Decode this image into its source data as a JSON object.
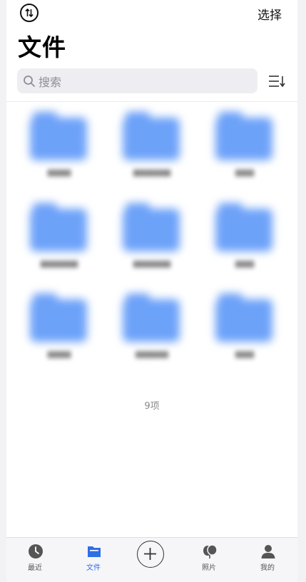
{
  "header": {
    "sync_icon": "sort-swap-icon",
    "select_label": "选择",
    "title": "文件"
  },
  "search": {
    "placeholder": "搜索",
    "icon": "search-icon"
  },
  "sort_icon": "sort-list-icon",
  "folders": [
    {
      "name": "▮▮▮▮▮",
      "icon": "folder-icon"
    },
    {
      "name": "▮▮▮▮▮▮▮▮",
      "icon": "folder-icon"
    },
    {
      "name": "▮▮▮▮",
      "icon": "folder-icon"
    },
    {
      "name": "▮▮▮▮▮▮▮▮",
      "icon": "folder-icon"
    },
    {
      "name": "▮▮▮▮▮▮▮▮",
      "icon": "folder-icon"
    },
    {
      "name": "▮▮▮▮",
      "icon": "folder-icon"
    },
    {
      "name": "▮▮▮▮▮",
      "icon": "folder-icon"
    },
    {
      "name": "▮▮▮▮▮▮▮",
      "icon": "folder-icon"
    },
    {
      "name": "▮▮▮▮",
      "icon": "folder-icon"
    }
  ],
  "item_count": "9项",
  "tabbar": {
    "items": [
      {
        "label": "最近",
        "icon": "clock-icon"
      },
      {
        "label": "文件",
        "icon": "folder-icon",
        "active": true
      },
      {
        "label": "",
        "icon": "plus-circle-icon"
      },
      {
        "label": "照片",
        "icon": "photos-icon"
      },
      {
        "label": "我的",
        "icon": "person-icon"
      }
    ]
  },
  "colors": {
    "accent": "#2f6fe6",
    "folder": "#6da2f9",
    "search_bg": "#eeeef2"
  }
}
